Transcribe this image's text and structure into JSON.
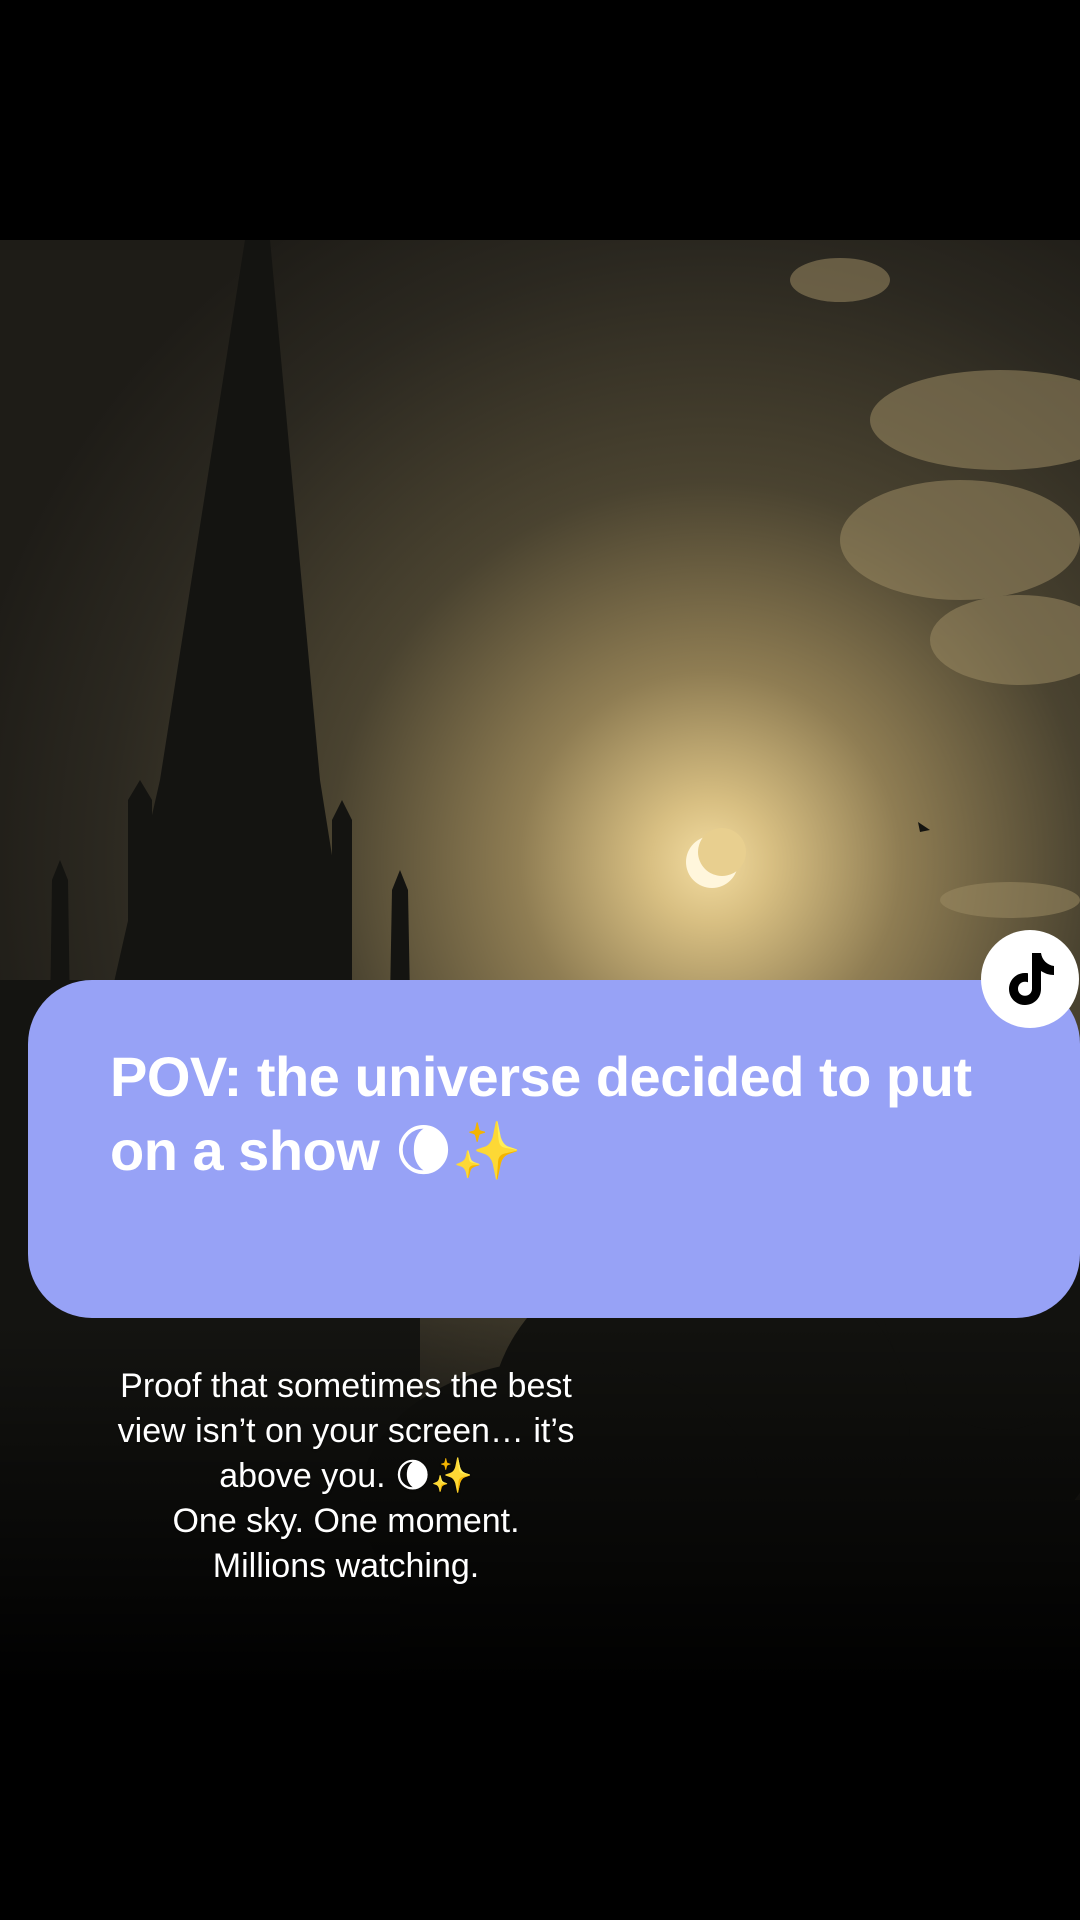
{
  "post": {
    "overlay_title": "POV: the universe decided to put on a show 🌘✨",
    "description_lines": [
      "Proof that sometimes the best",
      "view isn’t on your screen… it’s",
      "above you. 🌘✨",
      "One sky. One moment.",
      "Millions watching."
    ]
  },
  "badge": {
    "icon": "tiktok-logo-icon"
  },
  "colors": {
    "card": "#97a2f6",
    "background": "#000000",
    "sky_glow": "#f3d99a"
  }
}
